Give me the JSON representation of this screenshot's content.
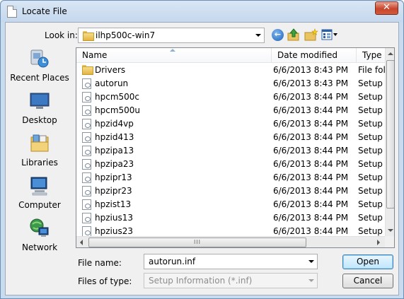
{
  "window": {
    "title": "Locate File",
    "close_glyph": "✕"
  },
  "toolbar": {
    "look_in_label": "Look in:",
    "look_in_value": "ilhp500c-win7",
    "back_glyph": "←",
    "icons": [
      "back-icon",
      "up-folder-icon",
      "new-folder-icon",
      "views-menu-icon"
    ]
  },
  "places": [
    {
      "label": "Recent Places",
      "icon": "recent-places-icon"
    },
    {
      "label": "Desktop",
      "icon": "desktop-icon"
    },
    {
      "label": "Libraries",
      "icon": "libraries-icon"
    },
    {
      "label": "Computer",
      "icon": "computer-icon"
    },
    {
      "label": "Network",
      "icon": "network-icon"
    }
  ],
  "columns": {
    "name": "Name",
    "date": "Date modified",
    "type": "Type"
  },
  "files": [
    {
      "name": "Drivers",
      "date": "6/6/2013 8:43 PM",
      "type": "File fol",
      "kind": "folder"
    },
    {
      "name": "autorun",
      "date": "6/6/2013 8:43 PM",
      "type": "Setup I",
      "kind": "file"
    },
    {
      "name": "hpcm500c",
      "date": "6/6/2013 8:44 PM",
      "type": "Setup I",
      "kind": "file"
    },
    {
      "name": "hpcm500u",
      "date": "6/6/2013 8:44 PM",
      "type": "Setup I",
      "kind": "file"
    },
    {
      "name": "hpzid4vp",
      "date": "6/6/2013 8:44 PM",
      "type": "Setup I",
      "kind": "file"
    },
    {
      "name": "hpzid413",
      "date": "6/6/2013 8:44 PM",
      "type": "Setup I",
      "kind": "file"
    },
    {
      "name": "hpzipa13",
      "date": "6/6/2013 8:44 PM",
      "type": "Setup I",
      "kind": "file"
    },
    {
      "name": "hpzipa23",
      "date": "6/6/2013 8:44 PM",
      "type": "Setup I",
      "kind": "file"
    },
    {
      "name": "hpzipr13",
      "date": "6/6/2013 8:44 PM",
      "type": "Setup I",
      "kind": "file"
    },
    {
      "name": "hpzipr23",
      "date": "6/6/2013 8:44 PM",
      "type": "Setup I",
      "kind": "file"
    },
    {
      "name": "hpzist13",
      "date": "6/6/2013 8:44 PM",
      "type": "Setup I",
      "kind": "file"
    },
    {
      "name": "hpzius13",
      "date": "6/6/2013 8:44 PM",
      "type": "Setup I",
      "kind": "file"
    },
    {
      "name": "hpzius23",
      "date": "6/6/2013 8:44 PM",
      "type": "Setup I",
      "kind": "file"
    }
  ],
  "scrollbar": {
    "grip": "III"
  },
  "filename": {
    "label": "File name:",
    "value": "autorun.inf"
  },
  "filetype": {
    "label": "Files of type:",
    "value": "Setup Information (*.inf)"
  },
  "buttons": {
    "open": "Open",
    "cancel": "Cancel"
  },
  "colors": {
    "title_bar": "#c5d8ee",
    "close_button": "#c7452c",
    "dialog_body": "#f0f0f0",
    "default_button": "#bee6fd"
  }
}
